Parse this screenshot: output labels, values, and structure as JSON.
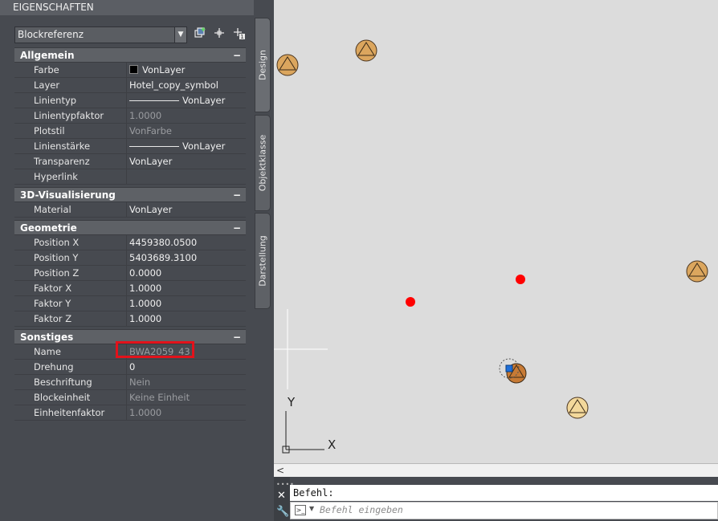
{
  "palette": {
    "title": "EIGENSCHAFTEN",
    "selector_value": "Blockreferenz",
    "toolbar_icons": [
      "quick-select-icon",
      "select-objects-icon",
      "toggle-pickadd-icon"
    ]
  },
  "categories": [
    {
      "title": "Allgemein",
      "toggle": "−",
      "rows": [
        {
          "name": "Farbe",
          "value": "VonLayer",
          "swatch_color": "#000000"
        },
        {
          "name": "Layer",
          "value": "Hotel_copy_symbol"
        },
        {
          "name": "Linientyp",
          "value": "VonLayer"
        },
        {
          "name": "Linientypfaktor",
          "value": "1.0000"
        },
        {
          "name": "Plotstil",
          "value": "VonFarbe"
        },
        {
          "name": "Linienstärke",
          "value": "VonLayer"
        },
        {
          "name": "Transparenz",
          "value": "VonLayer"
        },
        {
          "name": "Hyperlink",
          "value": ""
        }
      ]
    },
    {
      "title": "3D-Visualisierung",
      "toggle": "−",
      "rows": [
        {
          "name": "Material",
          "value": "VonLayer"
        }
      ]
    },
    {
      "title": "Geometrie",
      "toggle": "−",
      "rows": [
        {
          "name": "Position X",
          "value": "4459380.0500"
        },
        {
          "name": "Position Y",
          "value": "5403689.3100"
        },
        {
          "name": "Position Z",
          "value": "0.0000"
        },
        {
          "name": "Faktor X",
          "value": "1.0000"
        },
        {
          "name": "Faktor Y",
          "value": "1.0000"
        },
        {
          "name": "Faktor Z",
          "value": "1.0000"
        }
      ]
    },
    {
      "title": "Sonstiges",
      "toggle": "−",
      "rows": [
        {
          "name": "Name",
          "value": "BWA2059_43"
        },
        {
          "name": "Drehung",
          "value": "0"
        },
        {
          "name": "Beschriftung",
          "value": "Nein"
        },
        {
          "name": "Blockeinheit",
          "value": "Keine Einheit"
        },
        {
          "name": "Einheitenfaktor",
          "value": "1.0000"
        }
      ]
    }
  ],
  "tabs": [
    "Design",
    "Objektklasse",
    "Darstellung"
  ],
  "canvas": {
    "background": "#dcdcdc",
    "axis_x_label": "X",
    "axis_y_label": "Y",
    "symbol_color": "#dba65e",
    "symbol_light_color": "#f3d89b",
    "point_color": "#ff0000",
    "grip_color": "#1e6fd9"
  },
  "command": {
    "history": "Befehl:",
    "placeholder": "Befehl eingeben"
  },
  "colors": {
    "highlight": "#e3121b",
    "panel_bg": "#474a50"
  }
}
